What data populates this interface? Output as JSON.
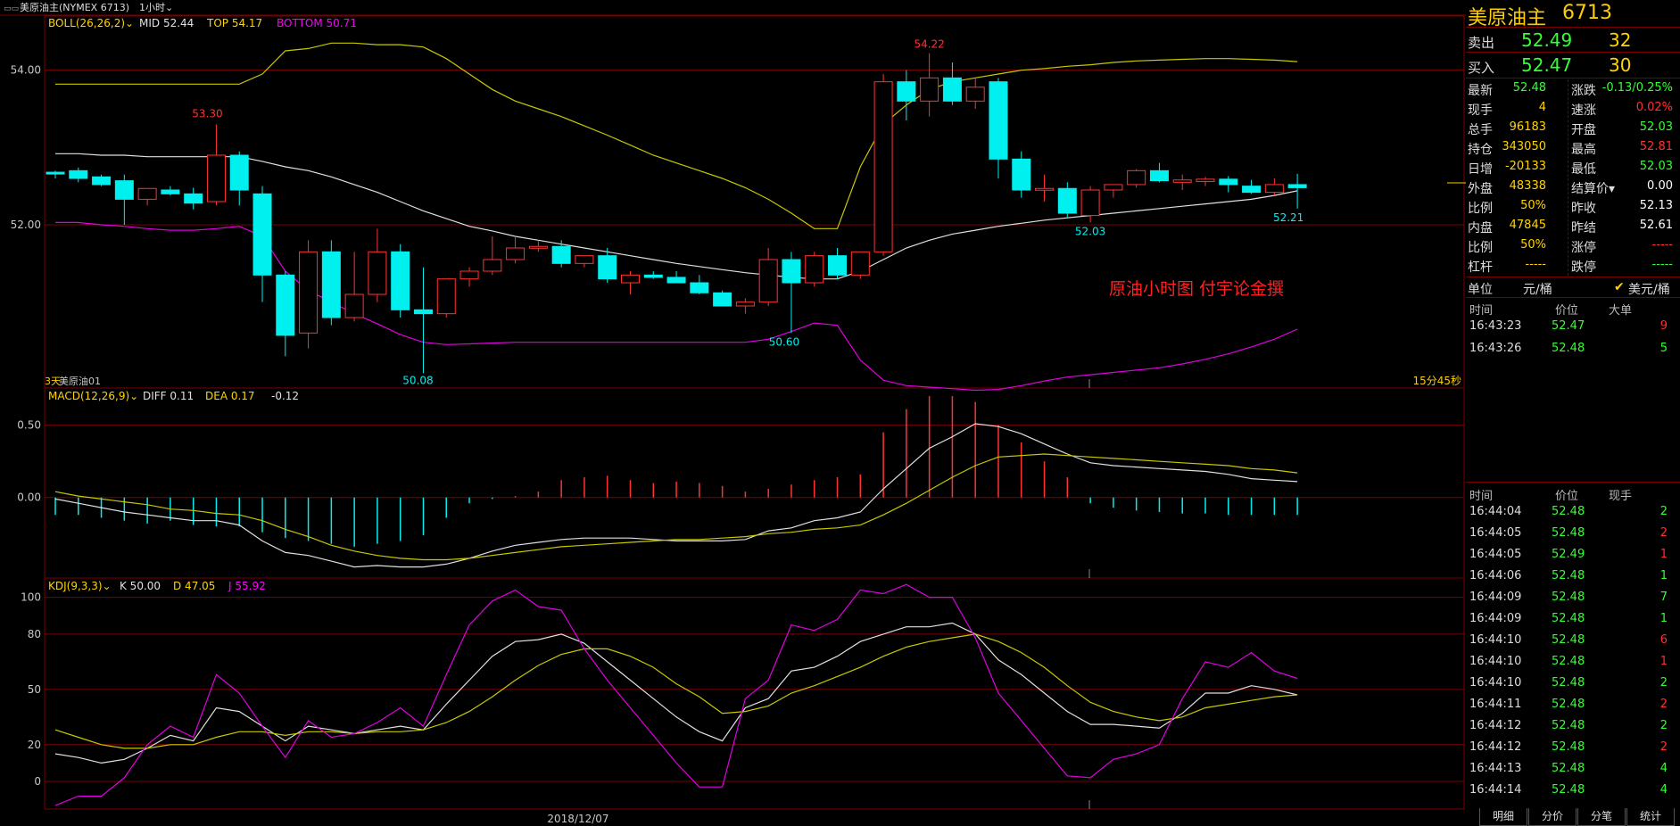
{
  "window": {
    "title": "美原油主(NYMEX 6713)",
    "period": "1小时"
  },
  "indicators": {
    "boll": {
      "label": "BOLL(26,26,2)",
      "mid": "MID 52.44",
      "top": "TOP 54.17",
      "bottom": "BOTTOM 50.71"
    },
    "macd": {
      "label": "MACD(12,26,9)",
      "diff": "DIFF 0.11",
      "dea": "DEA 0.17",
      "macd": "-0.12"
    },
    "kdj": {
      "label": "KDJ(9,3,3)",
      "k": "K 50.00",
      "d": "D 47.05",
      "j": "J 55.92"
    }
  },
  "annotations": {
    "high_54_22": "54.22",
    "high_53_30": "53.30",
    "low_50_08": "50.08",
    "low_50_60": "50.60",
    "low_52_03": "52.03",
    "low_52_21": "52.21",
    "left_tag": "3天",
    "series_tag": "美原油01",
    "right_tag": "15分45秒",
    "watermark": "原油小时图  付宇论金撰",
    "date": "2018/12/07"
  },
  "chart_data": [
    {
      "type": "candlestick",
      "title": "BOLL(26,26,2)",
      "ylim": [
        49.9,
        54.7
      ],
      "y_ticks": [
        "54.00",
        "52.00"
      ],
      "candles": [
        [
          52.68,
          52.7,
          52.6,
          52.66
        ],
        [
          52.7,
          52.74,
          52.55,
          52.6
        ],
        [
          52.62,
          52.65,
          52.5,
          52.52
        ],
        [
          52.57,
          52.65,
          52.0,
          52.33
        ],
        [
          52.33,
          52.45,
          52.25,
          52.47
        ],
        [
          52.45,
          52.5,
          52.38,
          52.4
        ],
        [
          52.4,
          52.48,
          52.2,
          52.28
        ],
        [
          52.3,
          53.3,
          52.25,
          52.9
        ],
        [
          52.9,
          52.95,
          52.25,
          52.45
        ],
        [
          52.4,
          52.5,
          51.0,
          51.35
        ],
        [
          51.35,
          51.4,
          50.3,
          50.57
        ],
        [
          50.6,
          51.8,
          50.4,
          51.65
        ],
        [
          51.65,
          51.8,
          50.7,
          50.8
        ],
        [
          50.8,
          51.65,
          50.75,
          51.1
        ],
        [
          51.1,
          51.95,
          51.0,
          51.65
        ],
        [
          51.65,
          51.75,
          50.8,
          50.9
        ],
        [
          50.9,
          51.45,
          50.08,
          50.85
        ],
        [
          50.85,
          51.3,
          50.8,
          51.3
        ],
        [
          51.3,
          51.45,
          51.2,
          51.4
        ],
        [
          51.4,
          51.85,
          51.35,
          51.55
        ],
        [
          51.55,
          51.85,
          51.5,
          51.7
        ],
        [
          51.7,
          51.8,
          51.65,
          51.72
        ],
        [
          51.72,
          51.8,
          51.45,
          51.5
        ],
        [
          51.5,
          51.58,
          51.45,
          51.6
        ],
        [
          51.6,
          51.7,
          51.25,
          51.3
        ],
        [
          51.25,
          51.4,
          51.1,
          51.35
        ],
        [
          51.35,
          51.4,
          51.3,
          51.32
        ],
        [
          51.32,
          51.4,
          51.25,
          51.25
        ],
        [
          51.25,
          51.35,
          51.1,
          51.12
        ],
        [
          51.12,
          51.15,
          50.95,
          50.95
        ],
        [
          50.95,
          51.05,
          50.85,
          51.0
        ],
        [
          51.0,
          51.7,
          50.95,
          51.55
        ],
        [
          51.55,
          51.65,
          50.6,
          51.25
        ],
        [
          51.25,
          51.65,
          51.2,
          51.6
        ],
        [
          51.6,
          51.7,
          51.3,
          51.35
        ],
        [
          51.35,
          51.65,
          51.3,
          51.65
        ],
        [
          51.65,
          53.95,
          51.6,
          53.85
        ],
        [
          53.85,
          54.0,
          53.35,
          53.6
        ],
        [
          53.6,
          54.22,
          53.4,
          53.9
        ],
        [
          53.9,
          54.1,
          53.55,
          53.6
        ],
        [
          53.6,
          53.9,
          53.5,
          53.78
        ],
        [
          53.85,
          53.9,
          52.6,
          52.85
        ],
        [
          52.85,
          52.95,
          52.35,
          52.45
        ],
        [
          52.45,
          52.65,
          52.3,
          52.47
        ],
        [
          52.47,
          52.55,
          52.1,
          52.15
        ],
        [
          52.12,
          52.5,
          52.03,
          52.45
        ],
        [
          52.45,
          52.52,
          52.35,
          52.52
        ],
        [
          52.52,
          52.72,
          52.48,
          52.7
        ],
        [
          52.7,
          52.8,
          52.55,
          52.57
        ],
        [
          52.55,
          52.65,
          52.45,
          52.58
        ],
        [
          52.56,
          52.62,
          52.5,
          52.59
        ],
        [
          52.59,
          52.63,
          52.42,
          52.52
        ],
        [
          52.5,
          52.58,
          52.4,
          52.42
        ],
        [
          52.42,
          52.6,
          52.38,
          52.52
        ],
        [
          52.52,
          52.66,
          52.21,
          52.48
        ]
      ],
      "boll_top": [
        53.82,
        53.82,
        53.82,
        53.82,
        53.82,
        53.82,
        53.82,
        53.82,
        53.82,
        53.95,
        54.25,
        54.28,
        54.35,
        54.35,
        54.33,
        54.33,
        54.3,
        54.15,
        53.95,
        53.75,
        53.6,
        53.5,
        53.4,
        53.28,
        53.16,
        53.03,
        52.9,
        52.8,
        52.7,
        52.6,
        52.48,
        52.33,
        52.15,
        51.95,
        51.95,
        52.75,
        53.3,
        53.55,
        53.75,
        53.85,
        53.9,
        53.95,
        54.0,
        54.02,
        54.05,
        54.07,
        54.1,
        54.12,
        54.13,
        54.14,
        54.15,
        54.15,
        54.14,
        54.13,
        54.11
      ],
      "boll_mid": [
        52.92,
        52.92,
        52.9,
        52.9,
        52.88,
        52.88,
        52.88,
        52.88,
        52.88,
        52.82,
        52.75,
        52.7,
        52.62,
        52.52,
        52.42,
        52.3,
        52.18,
        52.08,
        51.98,
        51.92,
        51.85,
        51.8,
        51.75,
        51.7,
        51.65,
        51.6,
        51.55,
        51.5,
        51.46,
        51.42,
        51.38,
        51.35,
        51.32,
        51.3,
        51.3,
        51.4,
        51.55,
        51.7,
        51.8,
        51.88,
        51.93,
        51.98,
        52.02,
        52.06,
        52.09,
        52.12,
        52.15,
        52.18,
        52.21,
        52.24,
        52.27,
        52.3,
        52.33,
        52.38,
        52.44
      ],
      "boll_bot": [
        52.03,
        52.03,
        52.0,
        51.98,
        51.95,
        51.93,
        51.93,
        51.95,
        51.98,
        51.85,
        51.4,
        51.15,
        51.0,
        50.85,
        50.72,
        50.58,
        50.48,
        50.45,
        50.46,
        50.47,
        50.48,
        50.48,
        50.48,
        50.48,
        50.48,
        50.48,
        50.48,
        50.48,
        50.48,
        50.48,
        50.48,
        50.52,
        50.62,
        50.73,
        50.7,
        50.25,
        49.99,
        49.92,
        49.9,
        49.88,
        49.86,
        49.87,
        49.92,
        49.98,
        50.03,
        50.06,
        50.09,
        50.12,
        50.15,
        50.2,
        50.26,
        50.33,
        50.42,
        50.52,
        50.65
      ]
    },
    {
      "type": "bar+line",
      "title": "MACD(12,26,9)",
      "ylim": [
        -0.55,
        0.75
      ],
      "y_ticks": [
        "0.50",
        "0.00"
      ],
      "hist": [
        -0.12,
        -0.12,
        -0.14,
        -0.16,
        -0.18,
        -0.16,
        -0.19,
        -0.2,
        -0.2,
        -0.24,
        -0.28,
        -0.3,
        -0.32,
        -0.34,
        -0.32,
        -0.3,
        -0.26,
        -0.14,
        -0.04,
        -0.01,
        0.01,
        0.04,
        0.12,
        0.14,
        0.15,
        0.12,
        0.1,
        0.11,
        0.1,
        0.08,
        0.04,
        0.06,
        0.09,
        0.12,
        0.14,
        0.16,
        0.45,
        0.61,
        0.7,
        0.7,
        0.66,
        0.5,
        0.38,
        0.25,
        0.14,
        -0.04,
        -0.07,
        -0.09,
        -0.1,
        -0.11,
        -0.11,
        -0.12,
        -0.12,
        -0.12,
        -0.12
      ],
      "diff": [
        -0.01,
        -0.04,
        -0.07,
        -0.1,
        -0.12,
        -0.14,
        -0.16,
        -0.16,
        -0.19,
        -0.3,
        -0.38,
        -0.4,
        -0.44,
        -0.48,
        -0.47,
        -0.48,
        -0.48,
        -0.46,
        -0.42,
        -0.37,
        -0.33,
        -0.31,
        -0.29,
        -0.28,
        -0.28,
        -0.28,
        -0.29,
        -0.3,
        -0.3,
        -0.3,
        -0.29,
        -0.23,
        -0.21,
        -0.16,
        -0.14,
        -0.1,
        0.06,
        0.2,
        0.34,
        0.42,
        0.51,
        0.49,
        0.44,
        0.37,
        0.3,
        0.24,
        0.22,
        0.21,
        0.2,
        0.19,
        0.18,
        0.16,
        0.13,
        0.12,
        0.11
      ],
      "dea": [
        0.04,
        0.01,
        -0.01,
        -0.03,
        -0.05,
        -0.08,
        -0.09,
        -0.11,
        -0.12,
        -0.16,
        -0.22,
        -0.27,
        -0.33,
        -0.37,
        -0.4,
        -0.42,
        -0.43,
        -0.43,
        -0.42,
        -0.4,
        -0.38,
        -0.36,
        -0.34,
        -0.33,
        -0.32,
        -0.31,
        -0.3,
        -0.29,
        -0.29,
        -0.28,
        -0.27,
        -0.25,
        -0.24,
        -0.22,
        -0.21,
        -0.19,
        -0.12,
        -0.04,
        0.05,
        0.14,
        0.22,
        0.28,
        0.29,
        0.3,
        0.29,
        0.28,
        0.27,
        0.26,
        0.25,
        0.24,
        0.23,
        0.22,
        0.2,
        0.19,
        0.17
      ]
    },
    {
      "type": "line",
      "title": "KDJ(9,3,3)",
      "ylim": [
        -15,
        110
      ],
      "y_ticks": [
        "100",
        "80",
        "50",
        "20",
        "0"
      ],
      "k": [
        15,
        13,
        10,
        12,
        18,
        25,
        22,
        40,
        38,
        30,
        22,
        30,
        28,
        26,
        28,
        30,
        28,
        42,
        55,
        68,
        76,
        77,
        80,
        75,
        65,
        55,
        45,
        35,
        27,
        22,
        40,
        45,
        60,
        62,
        68,
        76,
        80,
        84,
        84,
        86,
        80,
        66,
        58,
        48,
        38,
        31,
        31,
        30,
        29,
        37,
        48,
        48,
        52,
        50,
        47
      ],
      "d": [
        28,
        24,
        20,
        18,
        18,
        20,
        20,
        24,
        27,
        27,
        25,
        27,
        27,
        26,
        27,
        27,
        28,
        32,
        38,
        46,
        55,
        63,
        69,
        72,
        72,
        68,
        62,
        53,
        46,
        37,
        38,
        41,
        48,
        52,
        57,
        62,
        68,
        73,
        76,
        78,
        80,
        76,
        70,
        62,
        52,
        43,
        38,
        35,
        33,
        35,
        40,
        42,
        44,
        46,
        47
      ],
      "j": [
        -13,
        -8,
        -8,
        2,
        20,
        30,
        24,
        58,
        48,
        30,
        13,
        33,
        24,
        26,
        32,
        40,
        30,
        58,
        85,
        98,
        104,
        95,
        93,
        72,
        55,
        40,
        25,
        10,
        -3,
        -3,
        45,
        55,
        85,
        82,
        88,
        104,
        102,
        107,
        100,
        100,
        78,
        48,
        33,
        18,
        3,
        2,
        12,
        15,
        20,
        45,
        65,
        62,
        70,
        60,
        56
      ]
    }
  ],
  "right_panel": {
    "title_name": "美原油主",
    "title_code": "6713",
    "sell": {
      "label": "卖出",
      "price": "52.49",
      "vol": "32"
    },
    "buy": {
      "label": "买入",
      "price": "52.47",
      "vol": "30"
    },
    "stats": [
      {
        "l1": "最新",
        "v1": "52.48",
        "c1": "#34ff34",
        "l2": "涨跌",
        "v2": "-0.13/0.25%",
        "c2": "#34ff34"
      },
      {
        "l1": "现手",
        "v1": "4",
        "c1": "#ffd400",
        "l2": "速涨",
        "v2": "0.02%",
        "c2": "#ff3030"
      },
      {
        "l1": "总手",
        "v1": "96183",
        "c1": "#ffd400",
        "l2": "开盘",
        "v2": "52.03",
        "c2": "#34ff34"
      },
      {
        "l1": "持仓",
        "v1": "343050",
        "c1": "#ffd400",
        "l2": "最高",
        "v2": "52.81",
        "c2": "#ff3030"
      },
      {
        "l1": "日增",
        "v1": "-20133",
        "c1": "#ffd400",
        "l2": "最低",
        "v2": "52.03",
        "c2": "#34ff34"
      },
      {
        "l1": "外盘",
        "v1": "48338",
        "c1": "#ffd400",
        "l2": "结算价▾",
        "v2": "0.00",
        "c2": "#ffffff"
      },
      {
        "l1": "比例",
        "v1": "50%",
        "c1": "#ffd400",
        "l2": "昨收",
        "v2": "52.13",
        "c2": "#ffffff"
      },
      {
        "l1": "内盘",
        "v1": "47845",
        "c1": "#ffd400",
        "l2": "昨结",
        "v2": "52.61",
        "c2": "#ffffff"
      },
      {
        "l1": "比例",
        "v1": "50%",
        "c1": "#ffd400",
        "l2": "涨停",
        "v2": "-----",
        "c2": "#ff3030"
      },
      {
        "l1": "杠杆",
        "v1": "-----",
        "c1": "#ffd400",
        "l2": "跌停",
        "v2": "-----",
        "c2": "#34ff34"
      }
    ],
    "unit": {
      "label": "单位",
      "yuan": "元/桶",
      "usd": "美元/桶"
    },
    "big_head": {
      "time": "时间",
      "price": "价位",
      "vol": "大单"
    },
    "big_rows": [
      {
        "time": "16:43:23",
        "price": "52.47",
        "vol": "9",
        "color": "#ff3030"
      },
      {
        "time": "16:43:26",
        "price": "52.48",
        "vol": "5",
        "color": "#34ff34"
      }
    ],
    "tick_head": {
      "time": "时间",
      "price": "价位",
      "vol": "现手"
    },
    "tick_rows": [
      {
        "time": "16:44:04",
        "price": "52.48",
        "vol": "2",
        "color": "#34ff34"
      },
      {
        "time": "16:44:05",
        "price": "52.48",
        "vol": "2",
        "color": "#ff3030"
      },
      {
        "time": "16:44:05",
        "price": "52.49",
        "vol": "1",
        "color": "#ff3030"
      },
      {
        "time": "16:44:06",
        "price": "52.48",
        "vol": "1",
        "color": "#34ff34"
      },
      {
        "time": "16:44:09",
        "price": "52.48",
        "vol": "7",
        "color": "#34ff34"
      },
      {
        "time": "16:44:09",
        "price": "52.48",
        "vol": "1",
        "color": "#34ff34"
      },
      {
        "time": "16:44:10",
        "price": "52.48",
        "vol": "6",
        "color": "#ff3030"
      },
      {
        "time": "16:44:10",
        "price": "52.48",
        "vol": "1",
        "color": "#ff3030"
      },
      {
        "time": "16:44:10",
        "price": "52.48",
        "vol": "2",
        "color": "#34ff34"
      },
      {
        "time": "16:44:11",
        "price": "52.48",
        "vol": "2",
        "color": "#ff3030"
      },
      {
        "time": "16:44:12",
        "price": "52.48",
        "vol": "2",
        "color": "#34ff34"
      },
      {
        "time": "16:44:12",
        "price": "52.48",
        "vol": "2",
        "color": "#ff3030"
      },
      {
        "time": "16:44:13",
        "price": "52.48",
        "vol": "4",
        "color": "#34ff34"
      },
      {
        "time": "16:44:14",
        "price": "52.48",
        "vol": "4",
        "color": "#34ff34"
      }
    ],
    "tabs": [
      "明细",
      "分价",
      "分笔",
      "统计"
    ]
  },
  "colors": {
    "up": "#ff3232",
    "down": "#00f0f0",
    "grid": "#7a0000",
    "boll_top": "#c8c800",
    "boll_mid": "#e0e0e0",
    "boll_bot": "#e000e0",
    "dea": "#c8c800",
    "diff": "#e0e0e0",
    "j": "#e000e0"
  }
}
